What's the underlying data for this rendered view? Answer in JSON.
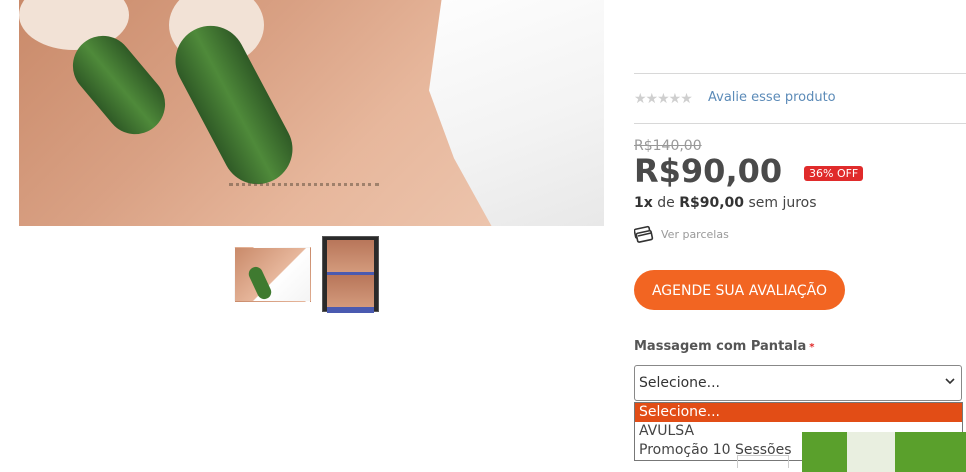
{
  "product": {
    "rating_stars": "★★★★★",
    "review_link": "Avalie esse produto",
    "old_price": "R$140,00",
    "price": "R$90,00",
    "discount_badge": "36% OFF",
    "installment": {
      "count": "1x",
      "of": "de",
      "amount": "R$90,00",
      "suffix": "sem juros"
    },
    "installments_link": "Ver parcelas",
    "cta_label": "AGENDE SUA AVALIAÇÃO"
  },
  "variation": {
    "label": "Massagem com Pantala",
    "required_mark": "*",
    "selected_value": "Selecione...",
    "chevron": "⌄",
    "options": [
      "Selecione...",
      "AVULSA",
      "Promoção 10 Sessões"
    ],
    "highlighted_index": 0
  },
  "colors": {
    "accent": "#f26522",
    "badge": "#e02b2b",
    "link": "#5c8bb8",
    "buy_button": "#5aa02c"
  }
}
